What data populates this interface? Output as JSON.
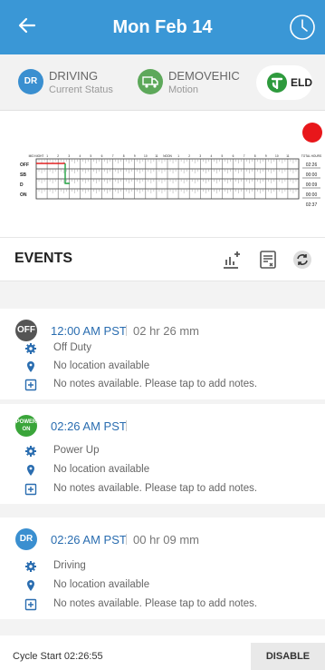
{
  "header": {
    "title": "Mon Feb 14",
    "back_icon": "arrow-left-icon",
    "clock_icon": "clock-icon"
  },
  "status": {
    "driving": {
      "badge": "DR",
      "line1": "DRIVING",
      "line2": "Current Status",
      "color": "#3a8fd0"
    },
    "vehicle": {
      "line1": "DEMOVEHIC",
      "line2": "Motion",
      "color": "#5da85a"
    },
    "eld": {
      "label": "ELD",
      "color": "#2e9a3d"
    }
  },
  "graph": {
    "row_labels": [
      "OFF",
      "SB",
      "D",
      "ON"
    ],
    "hour_labels_left": [
      "MID NIGHT",
      "1",
      "2",
      "3",
      "4",
      "5",
      "6",
      "7",
      "8",
      "9",
      "10",
      "11",
      "NOON"
    ],
    "hour_labels_right": [
      "1",
      "2",
      "3",
      "4",
      "5",
      "6",
      "7",
      "8",
      "9",
      "10",
      "11"
    ],
    "total_label": "TOTAL HOURS",
    "totals": [
      "02:26",
      "00:00",
      "00:09",
      "00:00"
    ],
    "grand_total": "02:37",
    "record_color": "#e8171b"
  },
  "events": {
    "title": "EVENTS",
    "items": [
      {
        "badge": "OFF",
        "badge_color": "#555555",
        "time": "12:00 AM PST",
        "duration": "02 hr 26 mm",
        "status": "Off Duty",
        "location": "No location available",
        "notes": "No notes available. Please tap to add notes."
      },
      {
        "badge": "POWER ON",
        "badge_color": "#3aa53a",
        "time": "02:26 AM PST",
        "duration": "",
        "status": "Power Up",
        "location": "No location available",
        "notes": "No notes available. Please tap to add notes."
      },
      {
        "badge": "DR",
        "badge_color": "#3a8fd0",
        "time": "02:26 AM PST",
        "duration": "00 hr 09 mm",
        "status": "Driving",
        "location": "No location available",
        "notes": "No notes available. Please tap to add notes."
      }
    ]
  },
  "footer": {
    "cycle_start": "Cycle Start 02:26:55",
    "disable_label": "DISABLE"
  }
}
